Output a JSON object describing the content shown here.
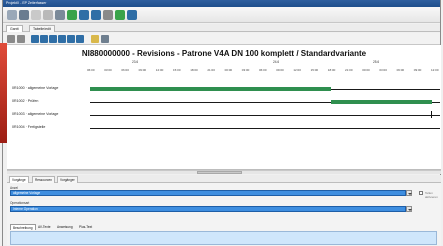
{
  "window": {
    "title": "ProjektX - EP Zeiterfasser"
  },
  "top_tabs": [
    {
      "label": "Gantt"
    },
    {
      "label": "Tabelle/edit"
    }
  ],
  "chart": {
    "title": "NI880000000 - Revisions - Patrone V4A DN 100 komplett / Standardvariante",
    "dates": [
      "23.6",
      "24.6",
      "25.6"
    ],
    "hours": [
      "06:00",
      "03:00",
      "06:00",
      "09:00",
      "12:00",
      "15:00",
      "18:00",
      "21:00",
      "00:00",
      "03:00",
      "06:00",
      "09:00",
      "12:00",
      "15:00",
      "18:00",
      "21:00",
      "00:00",
      "03:00",
      "06:00",
      "09:00",
      "12:00"
    ]
  },
  "rows": [
    {
      "label": "0R1000 · allgemeine Vorlage"
    },
    {
      "label": "0R1002 · Prüfen"
    },
    {
      "label": "0R1003 · allgemeine Vorlage"
    },
    {
      "label": "0R1004 · Fertigstelle"
    }
  ],
  "chart_data": {
    "type": "gantt",
    "tasks": [
      {
        "name": "0R1000 · allgemeine Vorlage",
        "start_frac": 0.0,
        "end_frac": 0.69
      },
      {
        "name": "0R1002 · Prüfen",
        "start_frac": 0.69,
        "end_frac": 0.98
      },
      {
        "name": "0R1003 · allgemeine Vorlage",
        "milestone_frac": 0.97
      },
      {
        "name": "0R1004 · Fertigstelle"
      }
    ]
  },
  "bottom_tabs": [
    {
      "label": "Vorgänge"
    },
    {
      "label": "Ressourcen"
    },
    {
      "label": "Vorgänger"
    }
  ],
  "panel": {
    "field1_label": "Anzel",
    "field1_value": "allgemeine Vorlage",
    "field2_label": "Operationsart",
    "field2_value": "Interne Operation",
    "checkbox_label": "Tellen aktivieren",
    "lower_tabs": [
      {
        "label": "Beschreibung"
      },
      {
        "label": "AV-Texte"
      },
      {
        "label": "Anweisung"
      },
      {
        "label": "Plus-Text"
      }
    ]
  },
  "colors": {
    "bar": "#2f8f4f",
    "selection": "#3e8ee0",
    "textarea": "#cfe6fb"
  }
}
